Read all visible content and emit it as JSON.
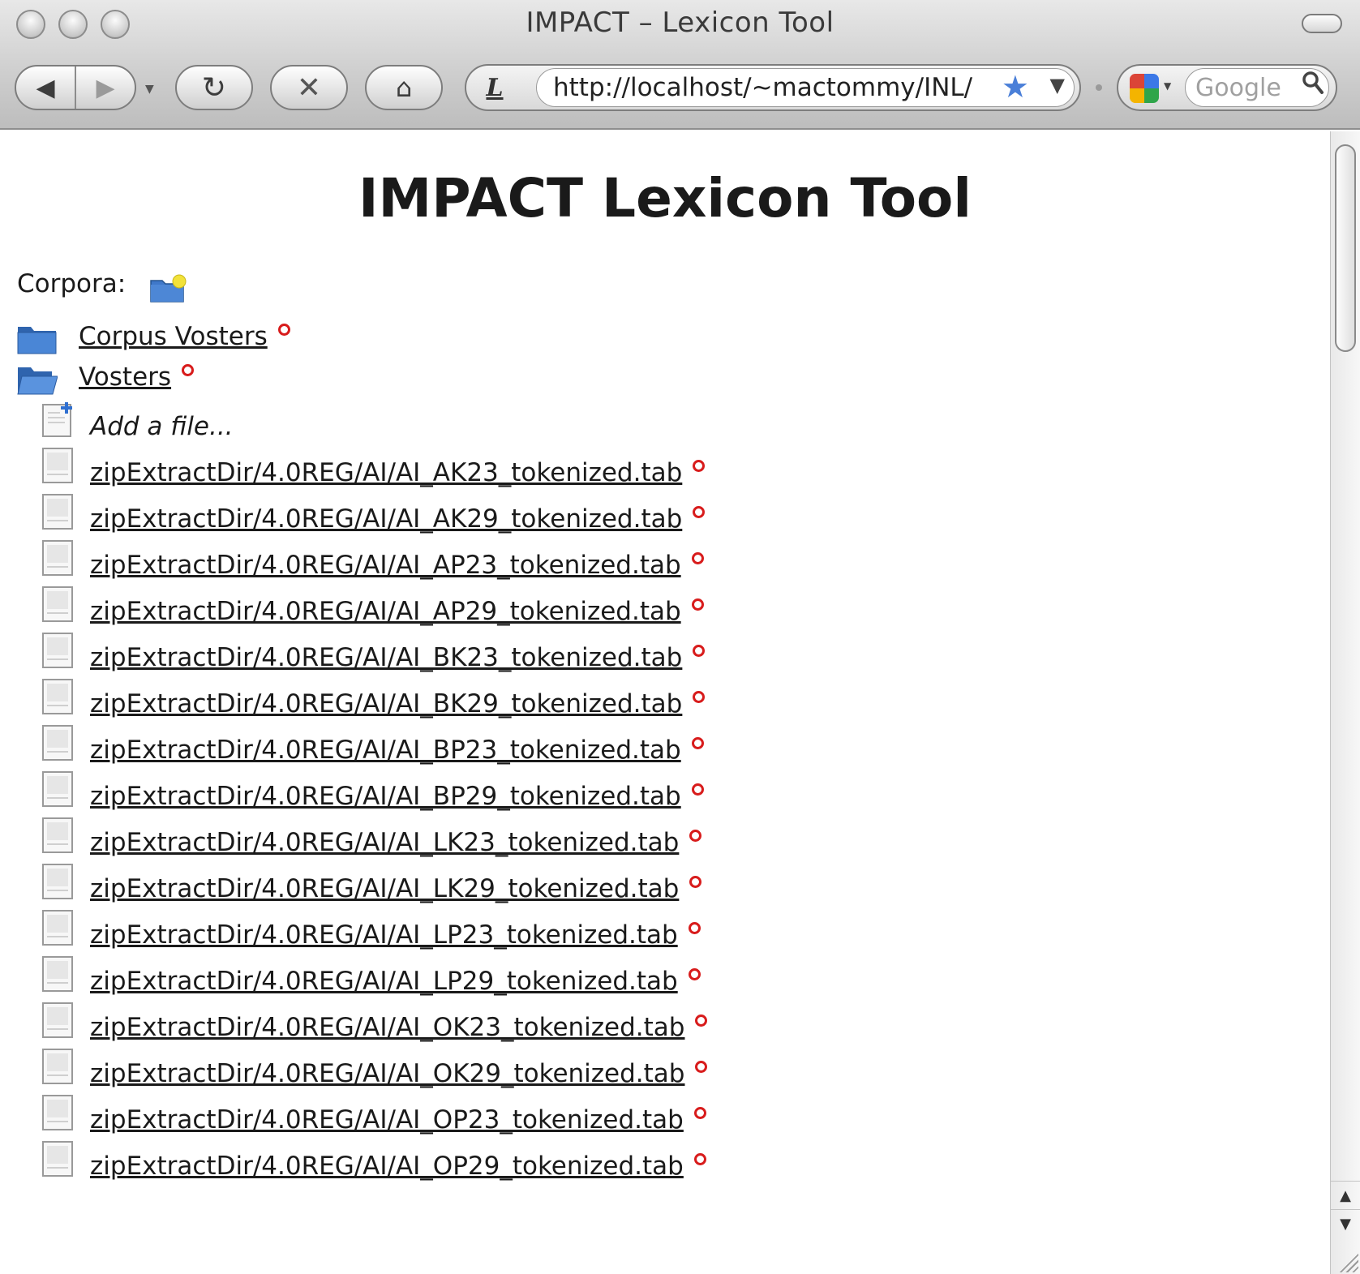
{
  "window": {
    "title": "IMPACT – Lexicon Tool"
  },
  "toolbar": {
    "back_glyph": "◀",
    "forward_glyph": "▶",
    "dropdown_glyph": "▼",
    "reload_glyph": "↻",
    "stop_glyph": "✕",
    "home_glyph": "⌂",
    "site_icon_glyph": "L",
    "url": "http://localhost/~mactommy/INL/",
    "bookmark_glyph": "★",
    "url_dropdown_glyph": "▼",
    "search_placeholder": "Google",
    "search_glyph": "🔍"
  },
  "page": {
    "title": "IMPACT Lexicon Tool",
    "corpora_label": "Corpora:",
    "corpora": [
      {
        "name": "Corpus Vosters"
      },
      {
        "name": "Vosters"
      }
    ],
    "add_file_label": "Add a file...",
    "files": [
      "zipExtractDir/4.0REG/AI/AI_AK23_tokenized.tab",
      "zipExtractDir/4.0REG/AI/AI_AK29_tokenized.tab",
      "zipExtractDir/4.0REG/AI/AI_AP23_tokenized.tab",
      "zipExtractDir/4.0REG/AI/AI_AP29_tokenized.tab",
      "zipExtractDir/4.0REG/AI/AI_BK23_tokenized.tab",
      "zipExtractDir/4.0REG/AI/AI_BK29_tokenized.tab",
      "zipExtractDir/4.0REG/AI/AI_BP23_tokenized.tab",
      "zipExtractDir/4.0REG/AI/AI_BP29_tokenized.tab",
      "zipExtractDir/4.0REG/AI/AI_LK23_tokenized.tab",
      "zipExtractDir/4.0REG/AI/AI_LK29_tokenized.tab",
      "zipExtractDir/4.0REG/AI/AI_LP23_tokenized.tab",
      "zipExtractDir/4.0REG/AI/AI_LP29_tokenized.tab",
      "zipExtractDir/4.0REG/AI/AI_OK23_tokenized.tab",
      "zipExtractDir/4.0REG/AI/AI_OK29_tokenized.tab",
      "zipExtractDir/4.0REG/AI/AI_OP23_tokenized.tab",
      "zipExtractDir/4.0REG/AI/AI_OP29_tokenized.tab"
    ]
  },
  "scrollbar": {
    "up_glyph": "▲",
    "down_glyph": "▼"
  },
  "colors": {
    "folder_blue": "#3f78c9",
    "delete_red": "#d81c1c",
    "new_badge_yellow": "#f2e23a",
    "add_plus_blue": "#2f6fd0"
  },
  "icons": {
    "corpus": "folder-icon",
    "new_corpus": "new-folder-icon",
    "file": "document-icon",
    "add_file": "add-document-icon",
    "delete": "delete-dot-icon"
  }
}
